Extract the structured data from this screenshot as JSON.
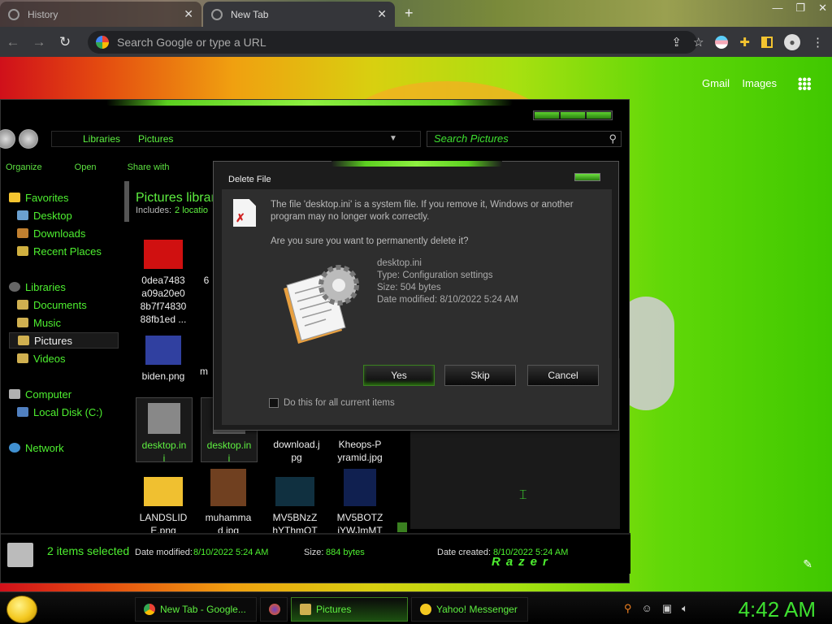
{
  "browser": {
    "tabs": [
      {
        "label": "History",
        "active": false
      },
      {
        "label": "New Tab",
        "active": true
      }
    ],
    "omnibox_placeholder": "Search Google or type a URL",
    "ntp_links": {
      "gmail": "Gmail",
      "images": "Images"
    }
  },
  "explorer": {
    "address": [
      "Libraries",
      "Pictures"
    ],
    "search_placeholder": "Search Pictures",
    "commands": [
      "Organize",
      "Open",
      "Share with"
    ],
    "nav": {
      "favorites": "Favorites",
      "favorites_items": [
        "Desktop",
        "Downloads",
        "Recent Places"
      ],
      "libraries": "Libraries",
      "libraries_items": [
        "Documents",
        "Music",
        "Pictures",
        "Videos"
      ],
      "computer": "Computer",
      "computer_items": [
        "Local Disk (C:)"
      ],
      "network": "Network"
    },
    "library_title": "Pictures librar",
    "includes_label": "Includes:",
    "includes_link": "2 locatio",
    "files": [
      {
        "name": "0dea7483\na09a20e0\n8b7f74830\n88fb1ed ...",
        "selected": false
      },
      {
        "name": "6",
        "selected": false
      },
      {
        "name": "biden.png",
        "selected": false
      },
      {
        "name": "m",
        "selected": false
      },
      {
        "name": "desktop.in\ni",
        "selected": true
      },
      {
        "name": "desktop.in\ni",
        "selected": true
      },
      {
        "name": "download.j\npg",
        "selected": false
      },
      {
        "name": "Kheops-P\nyramid.jpg",
        "selected": false
      },
      {
        "name": "LANDSLID\nE.png",
        "selected": false
      },
      {
        "name": "muhamma\nd.jpg",
        "selected": false
      },
      {
        "name": "MV5BNzZ\nhYThmOT",
        "selected": false
      },
      {
        "name": "MV5BOTZ\njYWJmMT",
        "selected": false
      }
    ],
    "status": {
      "selected": "2 items selected",
      "date_modified_label": "Date modified:",
      "date_modified": "8/10/2022 5:24 AM",
      "size_label": "Size:",
      "size": "884 bytes",
      "date_created_label": "Date created:",
      "date_created": "8/10/2022 5:24 AM",
      "brand": "Razer"
    }
  },
  "dialog": {
    "title": "Delete File",
    "message": "The file 'desktop.ini' is a system file. If you remove it, Windows or another program may no longer work correctly.",
    "question": "Are you sure you want to permanently delete it?",
    "file_name": "desktop.ini",
    "file_type": "Type: Configuration settings",
    "file_size": "Size: 504 bytes",
    "file_date": "Date modified: 8/10/2022 5:24 AM",
    "buttons": {
      "yes": "Yes",
      "skip": "Skip",
      "cancel": "Cancel"
    },
    "checkbox_label": "Do this for all current items"
  },
  "taskbar": {
    "items": [
      "New Tab - Google...",
      "Pictures",
      "Yahoo! Messenger"
    ],
    "clock": "4:42 AM"
  },
  "colors": {
    "accent": "#4ef030",
    "dialog_bg": "#2e2e2e"
  }
}
